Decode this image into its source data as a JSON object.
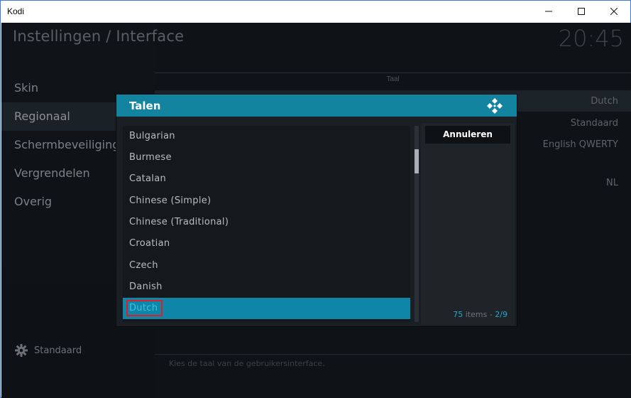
{
  "window": {
    "app_title": "Kodi"
  },
  "header": {
    "title": "Instellingen / Interface",
    "clock": "20:45"
  },
  "menu": {
    "items": [
      {
        "label": "Skin"
      },
      {
        "label": "Regionaal"
      },
      {
        "label": "Schermbeveiliging"
      },
      {
        "label": "Vergrendelen"
      },
      {
        "label": "Overig"
      }
    ],
    "active_index": 1
  },
  "footer": {
    "settings_level": "Standaard"
  },
  "settings": {
    "section_label": "Taal",
    "rows": [
      {
        "value": "Dutch"
      },
      {
        "value": "Standaard"
      },
      {
        "value": "English QWERTY"
      },
      {
        "value": "NL"
      }
    ],
    "help_text": "Kies de taal van de gebruikersinterface."
  },
  "dialog": {
    "title": "Talen",
    "items": [
      {
        "label": "Bulgarian"
      },
      {
        "label": "Burmese"
      },
      {
        "label": "Catalan"
      },
      {
        "label": "Chinese (Simple)"
      },
      {
        "label": "Chinese (Traditional)"
      },
      {
        "label": "Croatian"
      },
      {
        "label": "Czech"
      },
      {
        "label": "Danish"
      },
      {
        "label": "Dutch"
      }
    ],
    "focused_index": 8,
    "cancel_label": "Annuleren",
    "item_count": "75",
    "items_word": "items - ",
    "page_indicator": "2/9"
  },
  "colors": {
    "accent": "#12849f",
    "focus": "#0f86a8",
    "highlight_text": "#3ec0e6",
    "focus_border": "#d8202a"
  }
}
